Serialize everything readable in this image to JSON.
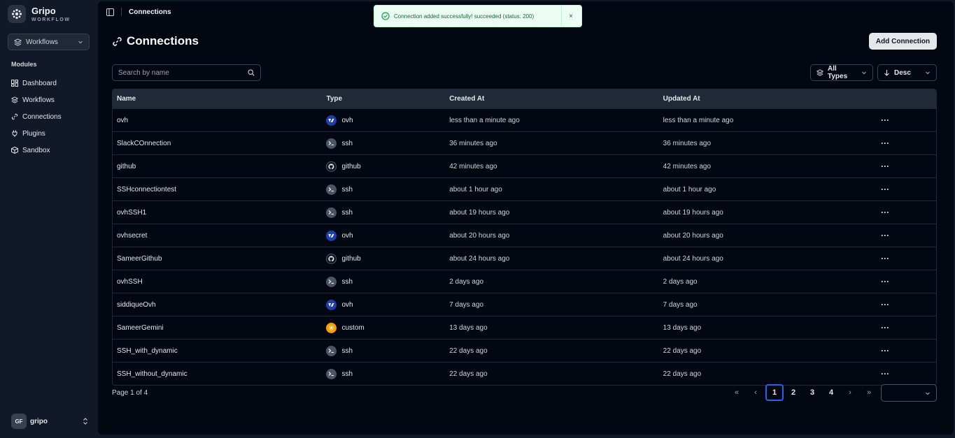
{
  "brand": {
    "name": "Gripo",
    "sub": "WORKFLOW"
  },
  "sidebar": {
    "workspace": "Workflows",
    "modules_label": "Modules",
    "items": [
      {
        "label": "Dashboard",
        "icon": "dashboard-icon"
      },
      {
        "label": "Workflows",
        "icon": "layers-icon"
      },
      {
        "label": "Connections",
        "icon": "link-icon"
      },
      {
        "label": "Plugins",
        "icon": "plug-icon"
      },
      {
        "label": "Sandbox",
        "icon": "box-icon"
      }
    ],
    "user": {
      "initials": "GF",
      "name": "gripo"
    }
  },
  "header": {
    "breadcrumb": "Connections"
  },
  "toast": {
    "message": "Connection added successfully! succeeded (status: 200)",
    "close": "×"
  },
  "page": {
    "title": "Connections",
    "add_button": "Add Connection",
    "search_placeholder": "Search by name",
    "type_filter": "All Types",
    "sort": "Desc"
  },
  "table": {
    "columns": {
      "name": "Name",
      "type": "Type",
      "created": "Created At",
      "updated": "Updated At"
    },
    "rows": [
      {
        "name": "ovh",
        "type": "ovh",
        "created": "less than a minute ago",
        "updated": "less than a minute ago"
      },
      {
        "name": "SlackCOnnection",
        "type": "ssh",
        "created": "36 minutes ago",
        "updated": "36 minutes ago"
      },
      {
        "name": "github",
        "type": "github",
        "created": "42 minutes ago",
        "updated": "42 minutes ago"
      },
      {
        "name": "SSHconnectiontest",
        "type": "ssh",
        "created": "about 1 hour ago",
        "updated": "about 1 hour ago"
      },
      {
        "name": "ovhSSH1",
        "type": "ssh",
        "created": "about 19 hours ago",
        "updated": "about 19 hours ago"
      },
      {
        "name": "ovhsecret",
        "type": "ovh",
        "created": "about 20 hours ago",
        "updated": "about 20 hours ago"
      },
      {
        "name": "SameerGithub",
        "type": "github",
        "created": "about 24 hours ago",
        "updated": "about 24 hours ago"
      },
      {
        "name": "ovhSSH",
        "type": "ssh",
        "created": "2 days ago",
        "updated": "2 days ago"
      },
      {
        "name": "siddiqueOvh",
        "type": "ovh",
        "created": "7 days ago",
        "updated": "7 days ago"
      },
      {
        "name": "SameerGemini",
        "type": "custom",
        "created": "13 days ago",
        "updated": "13 days ago"
      },
      {
        "name": "SSH_with_dynamic",
        "type": "ssh",
        "created": "22 days ago",
        "updated": "22 days ago"
      },
      {
        "name": "SSH_without_dynamic",
        "type": "ssh",
        "created": "22 days ago",
        "updated": "22 days ago"
      }
    ],
    "actions_label": "···"
  },
  "pagination": {
    "info": "Page 1 of 4",
    "first": "«",
    "prev": "‹",
    "pages": [
      "1",
      "2",
      "3",
      "4"
    ],
    "current": "1",
    "next": "›",
    "last": "»"
  },
  "colors": {
    "accent": "#2563eb",
    "toast_bg": "#ecfdf3",
    "toast_text": "#166534"
  }
}
